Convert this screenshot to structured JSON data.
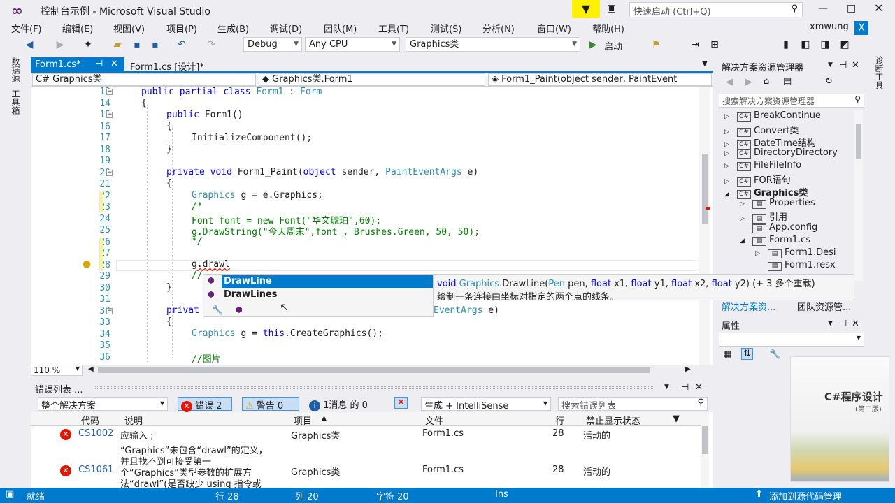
{
  "window": {
    "title": "控制台示例 - Microsoft Visual Studio",
    "quick_launch": "快速启动 (Ctrl+Q)",
    "user": "xmwung"
  },
  "menu": [
    "文件(F)",
    "编辑(E)",
    "视图(V)",
    "项目(P)",
    "生成(B)",
    "调试(D)",
    "团队(M)",
    "工具(T)",
    "测试(S)",
    "分析(N)",
    "窗口(W)",
    "帮助(H)"
  ],
  "toolbar": {
    "config": "Debug",
    "platform": "Any CPU",
    "project": "Graphics类",
    "start": "启动"
  },
  "left_tabs": [
    "数据源",
    "工具箱"
  ],
  "right_tab": "诊断工具",
  "doc_tabs": [
    {
      "label": "Form1.cs*",
      "active": true
    },
    {
      "label": "Form1.cs [设计]*",
      "active": false
    }
  ],
  "nav": {
    "project": "Graphics类",
    "class": "Graphics类.Form1",
    "member": "Form1_Paint(object sender, PaintEvent"
  },
  "editor": {
    "lines": [
      13,
      14,
      15,
      16,
      17,
      18,
      19,
      20,
      21,
      22,
      23,
      24,
      25,
      26,
      27,
      28,
      29,
      30,
      31,
      32,
      33,
      34,
      35,
      36
    ],
    "code": {
      "l13a": "public partial class ",
      "l13b": "Form1",
      " l13c": " : ",
      "l13d": "Form",
      "l14": "{",
      "l15a": "public ",
      "l15b": "Form1()",
      "l16": "{",
      "l17": "InitializeComponent();",
      "l18": "}",
      "l20a": "private void ",
      "l20b": "Form1_Paint(",
      "l20c": "object ",
      "l20d": "sender, ",
      "l20e": "PaintEventArgs ",
      "l20f": "e)",
      "l21": "{",
      "l22a": "Graphics ",
      "l22b": "g = e.Graphics;",
      "l23": "/*",
      "l24": "Font font = new Font(\"华文琥珀\",60);",
      "l25": "g.DrawString(\"今天周末\",font , Brushes.Green, 50, 50);",
      "l26": "*/",
      "l28": "g.drawl",
      "l29": "//",
      "l30": "}",
      "l32a": "privat",
      "l32b": "EventArgs ",
      "l32c": "e)",
      "l33": "{",
      "l34a": "Graphics ",
      "l34b": "g = ",
      "l34c": "this",
      ".l34d": ".CreateGraphics();",
      "l36": "//图片"
    },
    "zoom": "110 %"
  },
  "intellisense": {
    "items": [
      "DrawLine",
      "DrawLines"
    ],
    "selected": "DrawLine",
    "typed_match": "Draw"
  },
  "tooltip": {
    "sig_void": "void ",
    "sig_type": "Graphics",
    "sig_method": ".DrawLine(",
    "sig_p1t": "Pen ",
    "sig_p1": "pen, ",
    "sig_p2t": "float ",
    "sig_p2": "x1, ",
    "sig_p3t": "float ",
    "sig_p3": "y1, ",
    "sig_p4t": "float ",
    "sig_p4": "x2, ",
    "sig_p5t": "float ",
    "sig_p5": "y2) (+ 3 多个重载)",
    "desc": "绘制一条连接由坐标对指定的两个点的线条。"
  },
  "solution": {
    "title": "解决方案资源管理器",
    "search": "搜索解决方案资源管理器",
    "items": [
      {
        "label": "BreakContinue",
        "level": 0,
        "exp": "▷",
        "bold": false
      },
      {
        "label": "Convert类",
        "level": 0,
        "exp": "▷",
        "bold": false
      },
      {
        "label": "DateTime结构",
        "level": 0,
        "exp": "▷",
        "bold": false
      },
      {
        "label": "DirectoryDirectory",
        "level": 0,
        "exp": "▷",
        "bold": false
      },
      {
        "label": "FileFileInfo",
        "level": 0,
        "exp": "▷",
        "bold": false
      },
      {
        "label": "FOR语句",
        "level": 0,
        "exp": "▷",
        "bold": false
      },
      {
        "label": "Graphics类",
        "level": 0,
        "exp": "◢",
        "bold": true
      },
      {
        "label": "Properties",
        "level": 1,
        "exp": "▷",
        "bold": false
      },
      {
        "label": "引用",
        "level": 1,
        "exp": "▷",
        "bold": false
      },
      {
        "label": "App.config",
        "level": 1,
        "exp": "",
        "bold": false
      },
      {
        "label": "Form1.cs",
        "level": 1,
        "exp": "◢",
        "bold": false
      },
      {
        "label": "Form1.Desi",
        "level": 2,
        "exp": "▷",
        "bold": false
      },
      {
        "label": "Form1.resx",
        "level": 2,
        "exp": "",
        "bold": false
      }
    ],
    "bottom_tabs": [
      "解决方案资...",
      "团队资源管..."
    ]
  },
  "props": {
    "title": "属性"
  },
  "errorlist": {
    "title": "错误列表 ...",
    "scope": "整个解决方案",
    "errors_btn": "错误 2",
    "warnings_btn": "警告 0",
    "messages_btn": "1消息 的 0",
    "build_filter": "生成 + IntelliSense",
    "search": "搜索错误列表",
    "headers": [
      "代码",
      "说明",
      "项目",
      "文件",
      "行",
      "禁止显示状态"
    ],
    "rows": [
      {
        "code": "CS1002",
        "desc": [
          "应输入 ;"
        ],
        "project": "Graphics类",
        "file": "Form1.cs",
        "line": "28",
        "state": "活动的"
      },
      {
        "code": "CS1061",
        "desc": [
          "“Graphics”未包含“drawl”的定义，",
          "并且找不到可接受第一",
          "个“Graphics”类型参数的扩展方",
          "法“drawl”(是否缺少 using 指令或"
        ],
        "project": "Graphics类",
        "file": "Form1.cs",
        "line": "28",
        "state": "活动的"
      }
    ]
  },
  "status": {
    "ready": "就绪",
    "row": "行 28",
    "col": "列 20",
    "char": "字符 20",
    "ins": "Ins",
    "add_src": "添加到源代码管理"
  },
  "book": {
    "title": "C#程序设计",
    "edition": "(第二版)"
  },
  "colors": {
    "accent": "#007acc",
    "error": "#e51400",
    "keyword": "#0000ff",
    "type": "#2b91af",
    "comment": "#008000",
    "selection": "#007acc"
  }
}
